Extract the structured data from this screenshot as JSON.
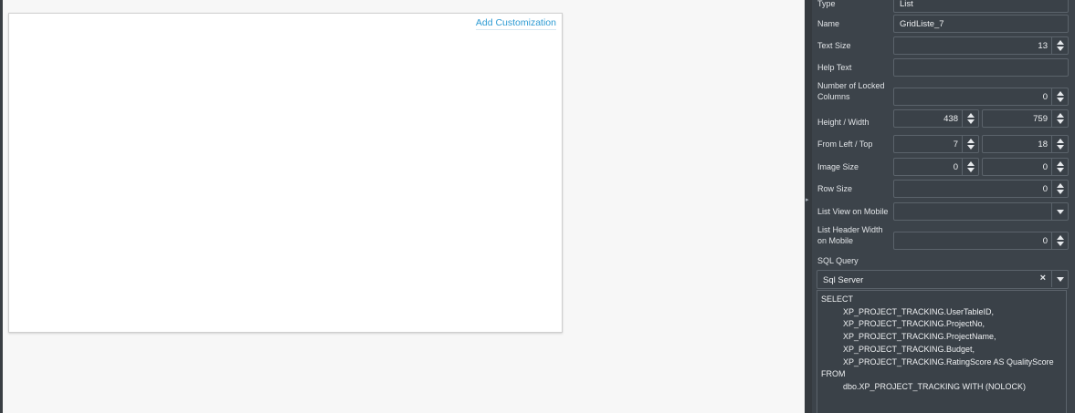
{
  "canvas": {
    "add_customization": "Add Customization"
  },
  "props": {
    "type": {
      "label": "Type",
      "value": "List"
    },
    "name": {
      "label": "Name",
      "value": "GridListe_7"
    },
    "text_size": {
      "label": "Text Size",
      "value": "13"
    },
    "help_text": {
      "label": "Help Text",
      "value": ""
    },
    "locked_cols": {
      "label_line1": "Number of Locked",
      "label_line2": "Columns",
      "value": "0"
    },
    "height_width": {
      "label": "Height / Width",
      "height": "438",
      "width": "759"
    },
    "from_left_top": {
      "label": "From Left / Top",
      "left": "7",
      "top": "18"
    },
    "image_size": {
      "label": "Image Size",
      "w": "0",
      "h": "0"
    },
    "row_size": {
      "label": "Row Size",
      "value": "0"
    },
    "list_view_mobile": {
      "label": "List View on Mobile",
      "value": ""
    },
    "list_header_width": {
      "label_line1": "List Header Width",
      "label_line2": "on Mobile",
      "value": "0"
    },
    "sql_query": {
      "label": "SQL Query",
      "engine": "Sql Server"
    }
  },
  "sql_lines": [
    {
      "text": "SELECT",
      "indent": false
    },
    {
      "text": "XP_PROJECT_TRACKING.UserTableID,",
      "indent": true
    },
    {
      "text": "XP_PROJECT_TRACKING.ProjectNo,",
      "indent": true
    },
    {
      "text": "XP_PROJECT_TRACKING.ProjectName,",
      "indent": true
    },
    {
      "text": "XP_PROJECT_TRACKING.Budget,",
      "indent": true
    },
    {
      "text": "XP_PROJECT_TRACKING.RatingScore AS QualityScore",
      "indent": true
    },
    {
      "text": "FROM",
      "indent": false
    },
    {
      "text": "dbo.XP_PROJECT_TRACKING WITH (NOLOCK)",
      "indent": true
    }
  ]
}
